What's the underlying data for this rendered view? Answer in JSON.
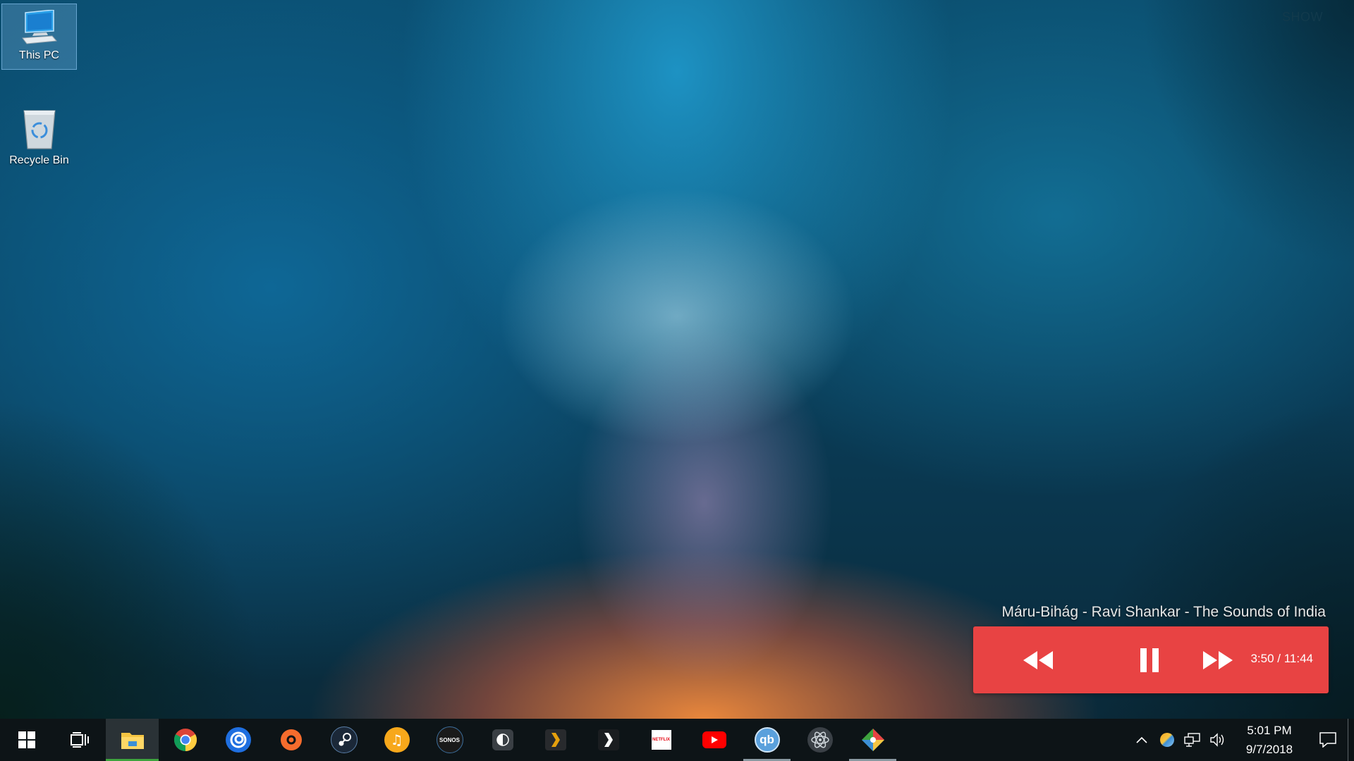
{
  "desktop": {
    "corner_link": "SHOW",
    "icons": [
      {
        "label": "This PC",
        "icon": "computer-icon"
      },
      {
        "label": "Recycle Bin",
        "icon": "recycle-bin-icon"
      }
    ]
  },
  "media_player": {
    "track_title": "Máru-Bihág - Ravi Shankar - The Sounds of India",
    "time": "3:50 / 11:44",
    "accent_color": "#e84343",
    "buttons": [
      "rewind",
      "pause",
      "fast-forward"
    ]
  },
  "taskbar": {
    "apps": [
      {
        "name": "start",
        "icon": "windows-logo-icon"
      },
      {
        "name": "task-view",
        "icon": "task-view-icon"
      },
      {
        "name": "file-explorer",
        "icon": "folder-icon",
        "state": "active"
      },
      {
        "name": "chrome",
        "icon": "chrome-icon"
      },
      {
        "name": "uplay",
        "icon": "uplay-icon"
      },
      {
        "name": "origin",
        "icon": "origin-icon"
      },
      {
        "name": "steam",
        "icon": "steam-icon"
      },
      {
        "name": "music-app",
        "icon": "music-note-icon"
      },
      {
        "name": "sonos",
        "icon": "sonos-icon",
        "text": "SONOS"
      },
      {
        "name": "media-app",
        "icon": "half-circle-icon"
      },
      {
        "name": "plex",
        "icon": "plex-chevron-icon"
      },
      {
        "name": "prompt-app",
        "icon": "chevron-right-icon"
      },
      {
        "name": "netflix",
        "icon": "netflix-icon",
        "text": "NETFLIX"
      },
      {
        "name": "youtube",
        "icon": "youtube-icon"
      },
      {
        "name": "qbittorrent",
        "icon": "qbittorrent-icon",
        "text": "qb",
        "state": "running"
      },
      {
        "name": "atom",
        "icon": "atom-icon"
      },
      {
        "name": "gitkraken",
        "icon": "git-icon",
        "state": "running"
      }
    ],
    "tray": {
      "clock_time": "5:01 PM",
      "clock_date": "9/7/2018"
    }
  }
}
